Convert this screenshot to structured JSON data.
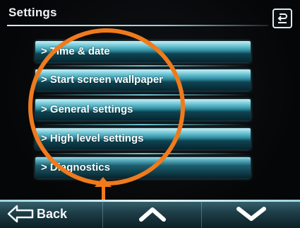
{
  "header": {
    "title": "Settings"
  },
  "menu": {
    "items": [
      {
        "label": "> Time & date"
      },
      {
        "label": "> Start screen wallpaper"
      },
      {
        "label": "> General settings"
      },
      {
        "label": "> High level settings"
      },
      {
        "label": "> Diagnostics"
      }
    ]
  },
  "bottom_bar": {
    "back_label": "Back"
  },
  "icons": {
    "header_back": "return-arrow-icon",
    "back": "arrow-left-outline-icon",
    "up": "chevron-up-icon",
    "down": "chevron-down-icon"
  },
  "colors": {
    "menu_accent": "#2f8fa3",
    "annotation": "#f07a1c",
    "background": "#050607"
  }
}
